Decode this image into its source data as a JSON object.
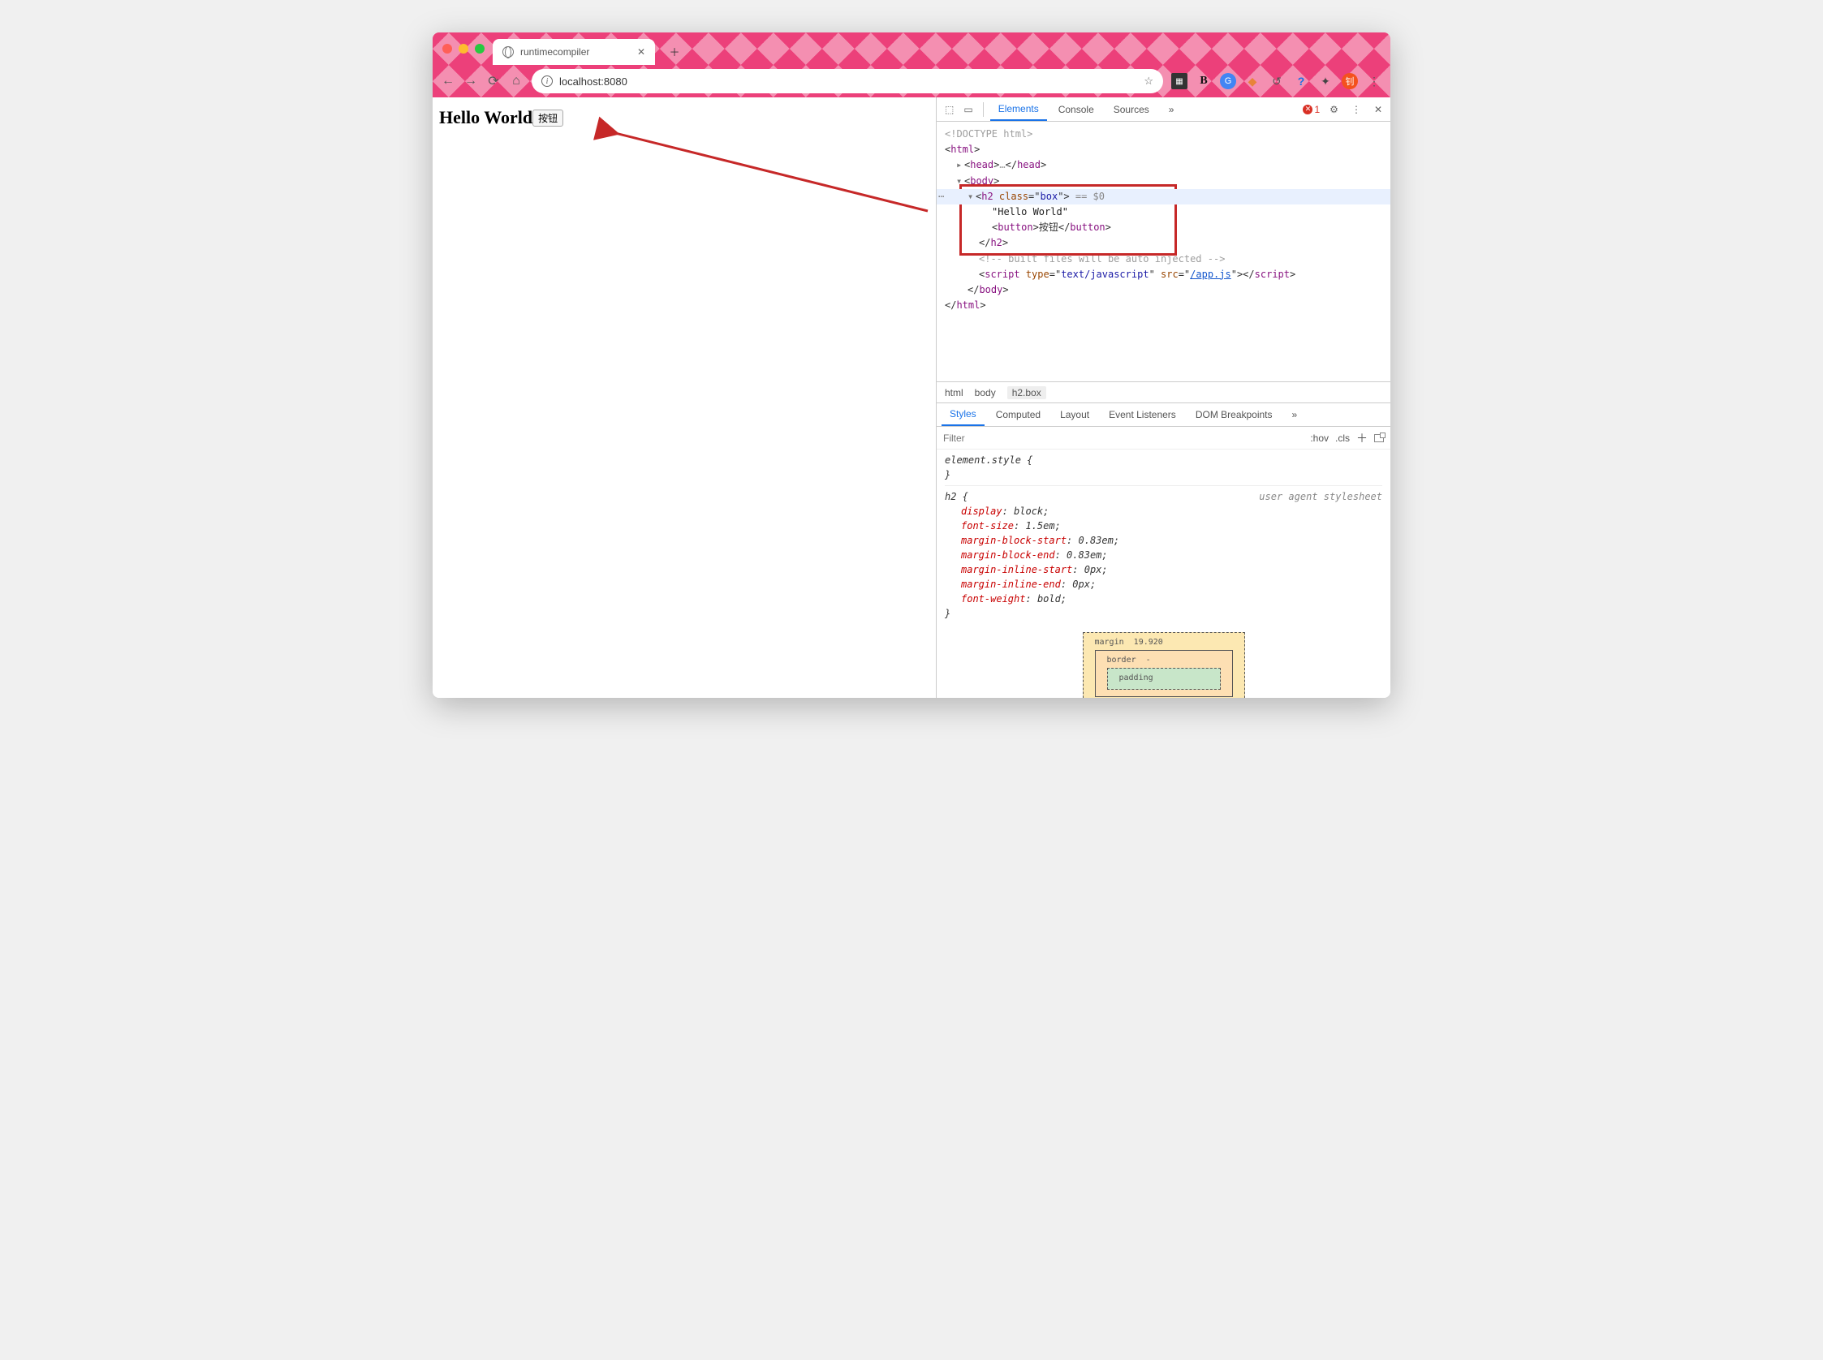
{
  "tab": {
    "title": "runtimecompiler"
  },
  "addressbar": {
    "url": "localhost:8080"
  },
  "page": {
    "heading": "Hello World",
    "button_label": "按钮"
  },
  "devtools": {
    "tabs": {
      "elements": "Elements",
      "console": "Console",
      "sources": "Sources"
    },
    "error_count": "1",
    "elements": {
      "doctype": "<!DOCTYPE html>",
      "html_open": "html",
      "head": "head",
      "head_ellipsis": "…",
      "body": "body",
      "h2_tag": "h2",
      "h2_class_attr": "class",
      "h2_class_val": "box",
      "eq0": " == $0",
      "text_node": "\"Hello World\"",
      "button_tag": "button",
      "button_text": "按钮",
      "comment": "<!-- built files will be auto injected -->",
      "script_tag": "script",
      "script_type_attr": "type",
      "script_type_val": "text/javascript",
      "script_src_attr": "src",
      "script_src_val": "/app.js"
    },
    "crumb": {
      "c1": "html",
      "c2": "body",
      "c3": "h2.box"
    },
    "subtabs": {
      "styles": "Styles",
      "computed": "Computed",
      "layout": "Layout",
      "listeners": "Event Listeners",
      "dom": "DOM Breakpoints"
    },
    "filter": {
      "placeholder": "Filter",
      "hov": ":hov",
      "cls": ".cls"
    },
    "styles": {
      "inline_sel": "element.style {",
      "inline_close": "}",
      "h2_sel": "h2 {",
      "ua": "user agent stylesheet",
      "p1": "display",
      "v1": "block",
      "p2": "font-size",
      "v2": "1.5em",
      "p3": "margin-block-start",
      "v3": "0.83em",
      "p4": "margin-block-end",
      "v4": "0.83em",
      "p5": "margin-inline-start",
      "v5": "0px",
      "p6": "margin-inline-end",
      "v6": "0px",
      "p7": "font-weight",
      "v7": "bold",
      "h2_close": "}"
    },
    "boxmodel": {
      "margin_label": "margin",
      "margin_top": "19.920",
      "border_label": "border",
      "border_val": "-",
      "padding_label": "padding"
    }
  }
}
